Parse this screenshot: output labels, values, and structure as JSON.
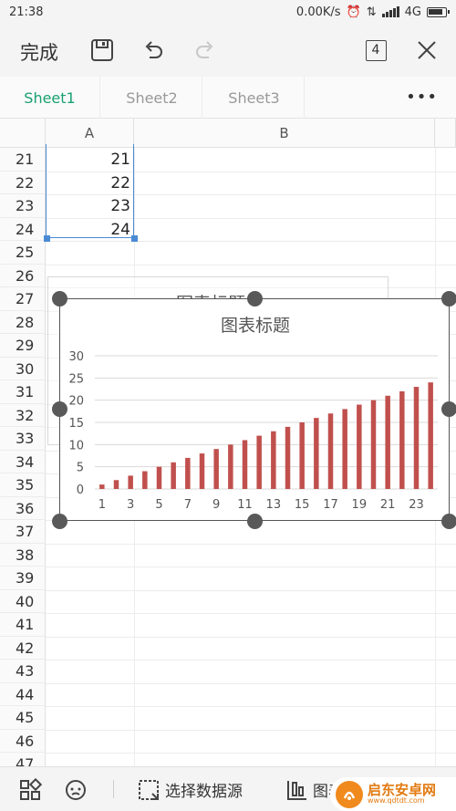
{
  "status_bar": {
    "time": "21:38",
    "speed": "0.00K/s",
    "network": "4G"
  },
  "toolbar": {
    "done_label": "完成",
    "sheet_count": "4"
  },
  "tabs": [
    {
      "label": "Sheet1",
      "active": true
    },
    {
      "label": "Sheet2",
      "active": false
    },
    {
      "label": "Sheet3",
      "active": false
    }
  ],
  "more_label": "•••",
  "columns": [
    "A",
    "B"
  ],
  "row_numbers": [
    "21",
    "22",
    "23",
    "24",
    "25",
    "26",
    "27",
    "28",
    "29",
    "30",
    "31",
    "32",
    "33",
    "34",
    "35",
    "36",
    "37",
    "38",
    "39",
    "40",
    "41",
    "42",
    "43",
    "44",
    "45",
    "46",
    "47"
  ],
  "cells_a": [
    "21",
    "22",
    "23",
    "24"
  ],
  "ghost_title": "图表标题",
  "chart_data": {
    "type": "bar",
    "title": "图表标题",
    "x": [
      1,
      2,
      3,
      4,
      5,
      6,
      7,
      8,
      9,
      10,
      11,
      12,
      13,
      14,
      15,
      16,
      17,
      18,
      19,
      20,
      21,
      22,
      23,
      24
    ],
    "x_tick_labels": [
      "1",
      "3",
      "5",
      "7",
      "9",
      "11",
      "13",
      "15",
      "17",
      "19",
      "21",
      "23"
    ],
    "values": [
      1,
      2,
      3,
      4,
      5,
      6,
      7,
      8,
      9,
      10,
      11,
      12,
      13,
      14,
      15,
      16,
      17,
      18,
      19,
      20,
      21,
      22,
      23,
      24
    ],
    "ylim": [
      0,
      30
    ],
    "y_ticks": [
      "0",
      "5",
      "10",
      "15",
      "20",
      "25",
      "30"
    ],
    "grid": true,
    "bar_color": "#c0504d",
    "xlabel": "",
    "ylabel": ""
  },
  "bottom_bar": {
    "select_source_label": "选择数据源",
    "chart_label_partial": "图表"
  },
  "watermark": {
    "text": "启东安卓网",
    "sub": "www.qdtdt.com"
  }
}
